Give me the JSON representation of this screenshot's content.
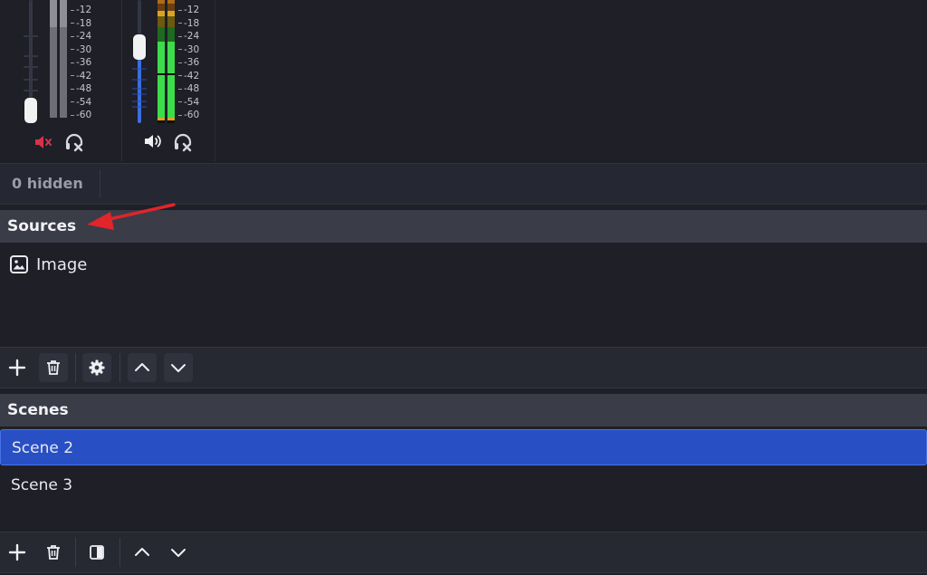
{
  "mixer": {
    "scale_ticks": [
      "-12",
      "-18",
      "-24",
      "-30",
      "-36",
      "-42",
      "-48",
      "-54",
      "-60"
    ],
    "channels": [
      {
        "muted": true,
        "mute_icon": "speaker-muted-icon",
        "monitor_icon": "headphones-off-icon",
        "volume_level": 0.1
      },
      {
        "muted": false,
        "mute_icon": "speaker-on-icon",
        "monitor_icon": "headphones-off-icon",
        "volume_level": 0.6
      }
    ],
    "hidden_label": "0 hidden"
  },
  "sources": {
    "title": "Sources",
    "items": [
      {
        "label": "Image",
        "icon": "image-icon"
      }
    ],
    "toolbar": [
      "add-icon",
      "trash-icon",
      "gear-icon",
      "chevron-up-icon",
      "chevron-down-icon"
    ]
  },
  "scenes": {
    "title": "Scenes",
    "items": [
      {
        "label": "Scene 2",
        "selected": true
      },
      {
        "label": "Scene 3",
        "selected": false
      }
    ],
    "toolbar": [
      "add-icon",
      "trash-icon",
      "filter-icon",
      "chevron-up-icon",
      "chevron-down-icon"
    ]
  },
  "colors": {
    "background": "#1e1f27",
    "header": "#3a3c48",
    "selection": "#284fc4",
    "meter_green": "#3ddc4a",
    "meter_yellow": "#d9a520",
    "muted_red": "#d6334a",
    "volume_blue": "#3b6fe0",
    "annotation_arrow": "#e0252b"
  }
}
